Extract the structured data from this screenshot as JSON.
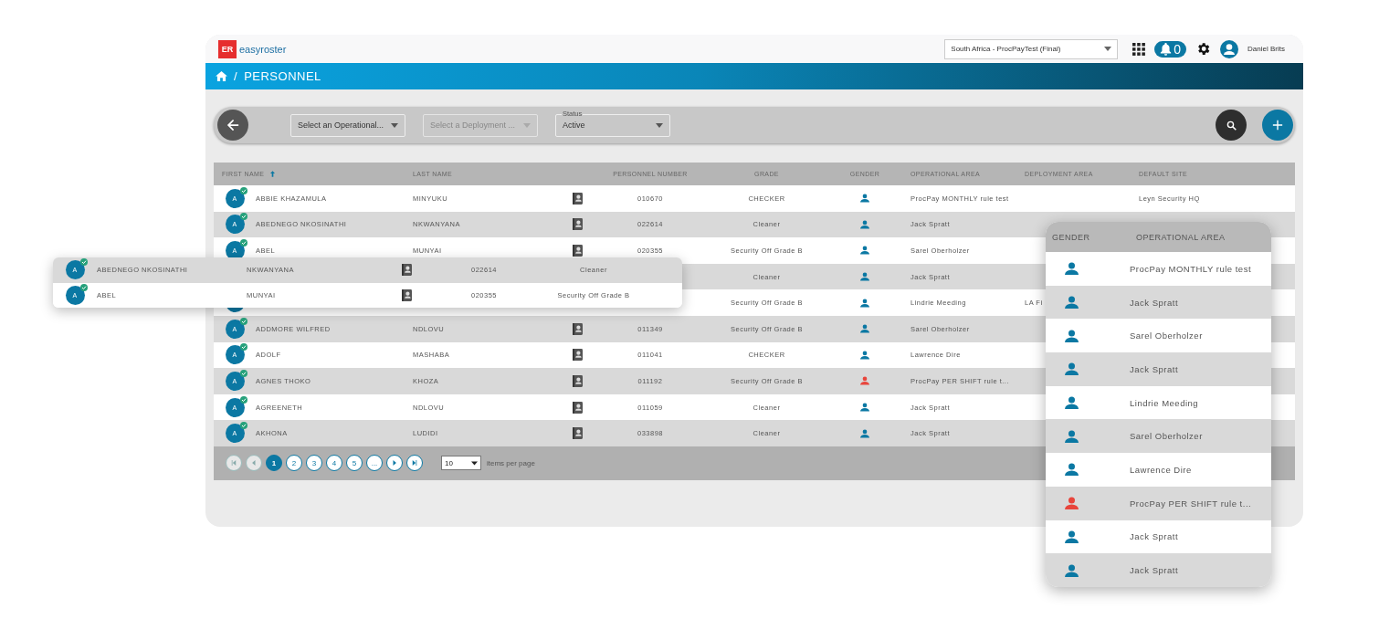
{
  "app": {
    "logo": "ER",
    "brand": "easyroster",
    "tenant": "South Africa - ProcPayTest (Final)",
    "notifications": "0",
    "user": "Daniel Brits"
  },
  "breadcrumb": {
    "separator": "/",
    "title": "PERSONNEL"
  },
  "filters": [
    {
      "placeholder": "Select an Operational...",
      "disabled": false
    },
    {
      "placeholder": "Select a Deployment ...",
      "disabled": true
    },
    {
      "label": "Status",
      "value": "Active",
      "disabled": false
    }
  ],
  "table": {
    "columns": [
      {
        "label": "FIRST NAME",
        "sorted": true
      },
      {
        "label": "LAST NAME",
        "sorted": false
      },
      {
        "label": "PERSONNEL NUMBER",
        "sorted": false
      },
      {
        "label": "GRADE",
        "sorted": false
      },
      {
        "label": "GENDER",
        "sorted": false
      },
      {
        "label": "OPERATIONAL AREA",
        "sorted": false
      },
      {
        "label": "DEPLOYMENT AREA",
        "sorted": false
      },
      {
        "label": "DEFAULT SITE",
        "sorted": false
      }
    ],
    "rows": [
      {
        "initial": "A",
        "first": "ABBIE KHAZAMULA",
        "last": "MINYUKU",
        "number": "010670",
        "grade": "CHECKER",
        "color": "#0b78a3",
        "area": "ProcPay MONTHLY rule test",
        "site": "Leyn Security HQ"
      },
      {
        "initial": "A",
        "first": "ABEDNEGO NKOSINATHI",
        "last": "NKWANYANA",
        "number": "022614",
        "grade": "Cleaner",
        "color": "#0b78a3",
        "area": "Jack Spratt"
      },
      {
        "initial": "A",
        "first": "ABEL",
        "last": "MUNYAI",
        "number": "020355",
        "grade": "Security Off Grade B",
        "color": "#0b78a3",
        "area": "Sarel Oberholzer"
      },
      {
        "grade": "Cleaner",
        "color": "#0b78a3",
        "area": "Jack Spratt"
      },
      {
        "grade": "Security Off Grade B",
        "color": "#0b78a3",
        "area": "Lindrie Meeding",
        "deployment": "LA Fi"
      },
      {
        "initial": "A",
        "first": "ADDMORE WILFRED",
        "last": "NDLOVU",
        "number": "011349",
        "grade": "Security Off Grade B",
        "color": "#0b78a3",
        "area": "Sarel Oberholzer"
      },
      {
        "initial": "A",
        "first": "ADOLF",
        "last": "MASHABA",
        "number": "011041",
        "grade": "CHECKER",
        "color": "#0b78a3",
        "area": "Lawrence Dire"
      },
      {
        "initial": "A",
        "first": "AGNES THOKO",
        "last": "KHOZA",
        "number": "011192",
        "grade": "Security Off Grade B",
        "color": "#e8453c",
        "area": "ProcPay PER SHIFT rule t..."
      },
      {
        "initial": "A",
        "first": "AGREENETH",
        "last": "NDLOVU",
        "number": "011059",
        "grade": "Cleaner",
        "color": "#0b78a3",
        "area": "Jack Spratt"
      },
      {
        "initial": "A",
        "first": "AKHONA",
        "last": "LUDIDI",
        "number": "033898",
        "grade": "Cleaner",
        "color": "#0b78a3",
        "area": "Jack Spratt"
      }
    ]
  },
  "pagination": {
    "pages": [
      {
        "label": "1",
        "selected": true
      },
      {
        "label": "2",
        "selected": false
      },
      {
        "label": "3",
        "selected": false
      },
      {
        "label": "4",
        "selected": false
      },
      {
        "label": "5",
        "selected": false
      },
      {
        "label": "...",
        "selected": false
      }
    ],
    "page_size": "10",
    "page_size_label": "items per page"
  },
  "popup_rows": [
    {
      "initial": "A",
      "first": "ABEDNEGO NKOSINATHI",
      "last": "NKWANYANA",
      "number": "022614",
      "grade": "Cleaner"
    },
    {
      "initial": "A",
      "first": "ABEL",
      "last": "MUNYAI",
      "number": "020355",
      "grade": "Security Off Grade B"
    }
  ],
  "zoom_panel": {
    "columns": [
      "GENDER",
      "OPERATIONAL AREA"
    ],
    "rows": [
      {
        "color": "#0b78a3",
        "area": "ProcPay MONTHLY rule test"
      },
      {
        "color": "#0b78a3",
        "area": "Jack Spratt"
      },
      {
        "color": "#0b78a3",
        "area": "Sarel Oberholzer"
      },
      {
        "color": "#0b78a3",
        "area": "Jack Spratt"
      },
      {
        "color": "#0b78a3",
        "area": "Lindrie Meeding"
      },
      {
        "color": "#0b78a3",
        "area": "Sarel Oberholzer"
      },
      {
        "color": "#0b78a3",
        "area": "Lawrence Dire"
      },
      {
        "color": "#e8453c",
        "area": "ProcPay PER SHIFT rule t..."
      },
      {
        "color": "#0b78a3",
        "area": "Jack Spratt"
      },
      {
        "color": "#0b78a3",
        "area": "Jack Spratt"
      }
    ]
  }
}
